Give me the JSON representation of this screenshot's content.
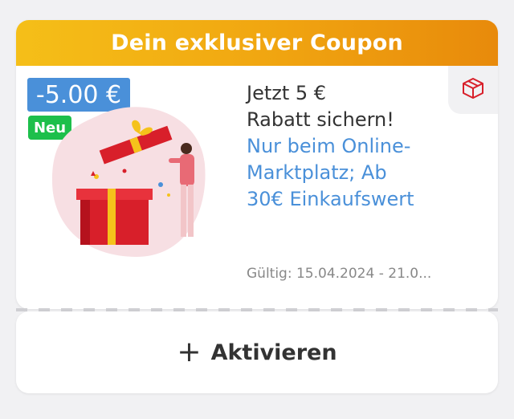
{
  "header": {
    "title": "Dein exklusiver Coupon"
  },
  "coupon": {
    "price_badge": "-5.00 €",
    "new_badge": "Neu",
    "title_line1": "Jetzt 5 €",
    "title_line2": "Rabatt sichern!",
    "subtitle_line1": "Nur beim Online-",
    "subtitle_line2": "Marktplatz; Ab",
    "subtitle_line3": "30€ Einkaufswert",
    "validity": "Gültig: 15.04.2024 - 21.0..."
  },
  "action": {
    "label": "Aktivieren",
    "icon": "plus-icon"
  },
  "icons": {
    "category": "package-icon"
  },
  "colors": {
    "header_gradient_start": "#f5bf18",
    "header_gradient_end": "#e88a0b",
    "price_badge": "#4a90d9",
    "new_badge": "#1dbf4b",
    "link_blue": "#4a90d9",
    "gift_red": "#d81f2a"
  }
}
